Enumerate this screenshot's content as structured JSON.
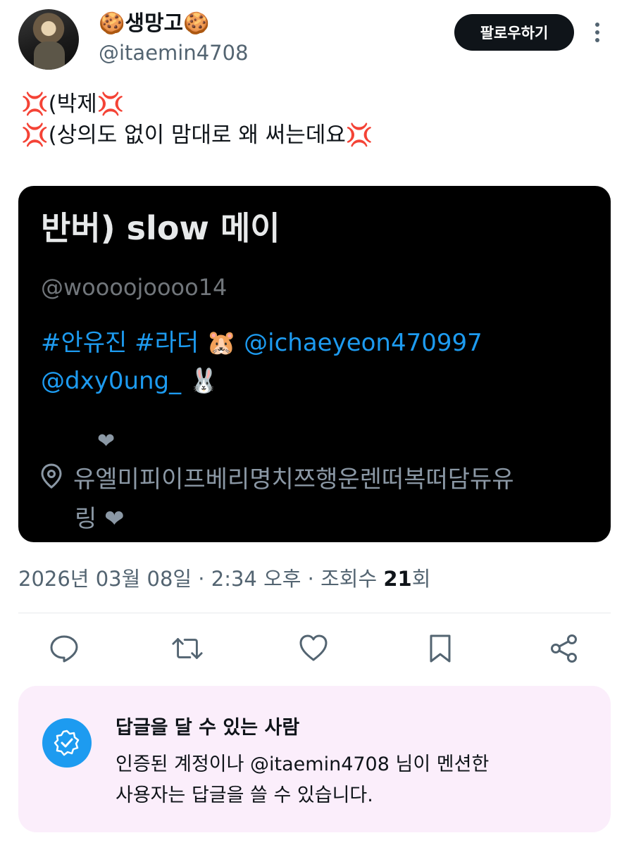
{
  "user": {
    "display_name": "🍪생망고🍪",
    "handle": "@itaemin4708",
    "follow_label": "팔로우하기"
  },
  "tweet": {
    "lines": [
      "💢(박제💢",
      "💢(상의도 없이 맘대로 왜 써는데요💢"
    ]
  },
  "card": {
    "title": "반버) slow 메이",
    "handle": "@woooojoooo14",
    "bio_line1": "#안유진 #라더 🐹 @ichaeyeon470997",
    "bio_line2": "@dxy0ung_ 🐰",
    "location_heart": "❤",
    "location_line1": "유엘미피이프베리명치쯔행운렌떠복떠담듀유",
    "location_line2": "링 ❤"
  },
  "meta": {
    "date_time": "2026년 03월 08일 · 2:34 오후 · 조회수 ",
    "view_count": "21",
    "view_suffix": "회"
  },
  "reply_restriction": {
    "title": "답글을 달 수 있는 사람",
    "desc_line1": "인증된 계정이나 @itaemin4708 님이 멘션한",
    "desc_line2": "사용자는 답글을 쓸 수 있습니다."
  },
  "colors": {
    "accent": "#1d9bf0",
    "text": "#0f1419",
    "muted": "#536471",
    "reply_box_bg": "#fbeefb"
  }
}
